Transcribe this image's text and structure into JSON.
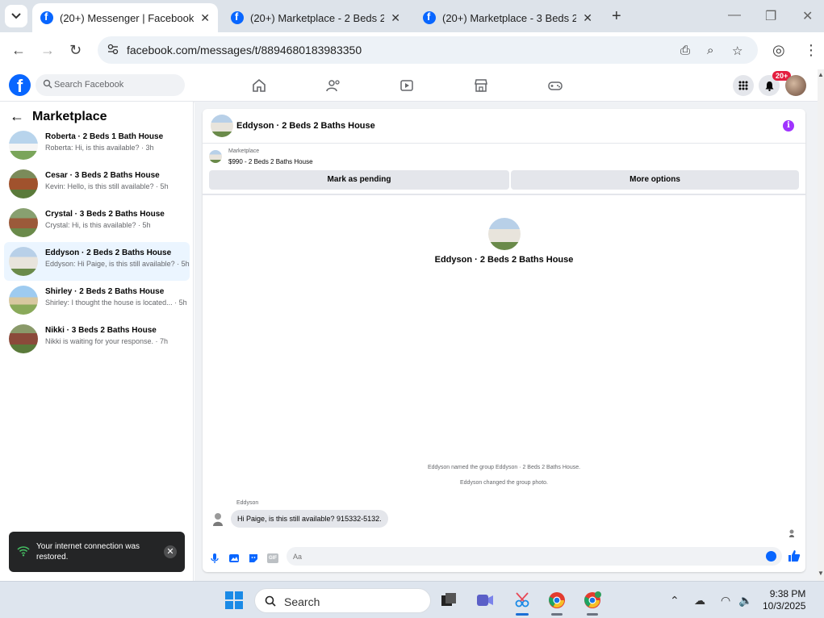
{
  "browser": {
    "tabs": [
      {
        "title": "(20+) Messenger | Facebook",
        "active": true
      },
      {
        "title": "(20+) Marketplace - 2 Beds 2 Ba",
        "active": false
      },
      {
        "title": "(20+) Marketplace - 3 Beds 2 Ba",
        "active": false
      }
    ],
    "url": "facebook.com/messages/t/8894680183983350"
  },
  "facebook": {
    "search_placeholder": "Search Facebook",
    "notification_badge": "20+"
  },
  "sidebar": {
    "title": "Marketplace",
    "conversations": [
      {
        "name": "Roberta · 2 Beds 1 Bath House",
        "preview": "Roberta: Hi, is this available? · 3h",
        "active": false
      },
      {
        "name": "Cesar · 3 Beds 2 Baths House",
        "preview": "Kevin: Hello, is this still available? · 5h",
        "active": false
      },
      {
        "name": "Crystal · 3 Beds 2 Baths House",
        "preview": "Crystal: Hi, is this available? · 5h",
        "active": false
      },
      {
        "name": "Eddyson · 2 Beds 2 Baths House",
        "preview": "Eddyson: Hi Paige, is this still available? · 5h",
        "active": true
      },
      {
        "name": "Shirley · 2 Beds 2 Baths House",
        "preview": "Shirley: I thought the house is located... · 5h",
        "active": false
      },
      {
        "name": "Nikki · 3 Beds 2 Baths House",
        "preview": "Nikki is waiting for your response. · 7h",
        "active": false
      }
    ]
  },
  "toast": {
    "message": "Your internet connection was restored."
  },
  "chat": {
    "header_name": "Eddyson · 2 Beds 2 Baths House",
    "marketplace_label": "Marketplace",
    "listing": "$990 - 2 Beds 2 Baths House",
    "mark_pending_label": "Mark as pending",
    "more_options_label": "More options",
    "center_name": "Eddyson · 2 Beds 2 Baths House",
    "system_messages": [
      "Eddyson named the group Eddyson · 2 Beds 2 Baths House.",
      "Eddyson changed the group photo."
    ],
    "sender": "Eddyson",
    "message": "Hi Paige, is this still available? 915332-5132.",
    "composer_placeholder": "Aa",
    "gif_label": "GIF"
  },
  "taskbar": {
    "search_placeholder": "Search",
    "time": "9:38 PM",
    "date": "10/3/2025"
  },
  "colors": {
    "facebook_blue": "#0866ff",
    "active_conversation_bg": "#ebf5ff",
    "info_purple": "#a033ff",
    "badge_red": "#e41e3f"
  }
}
